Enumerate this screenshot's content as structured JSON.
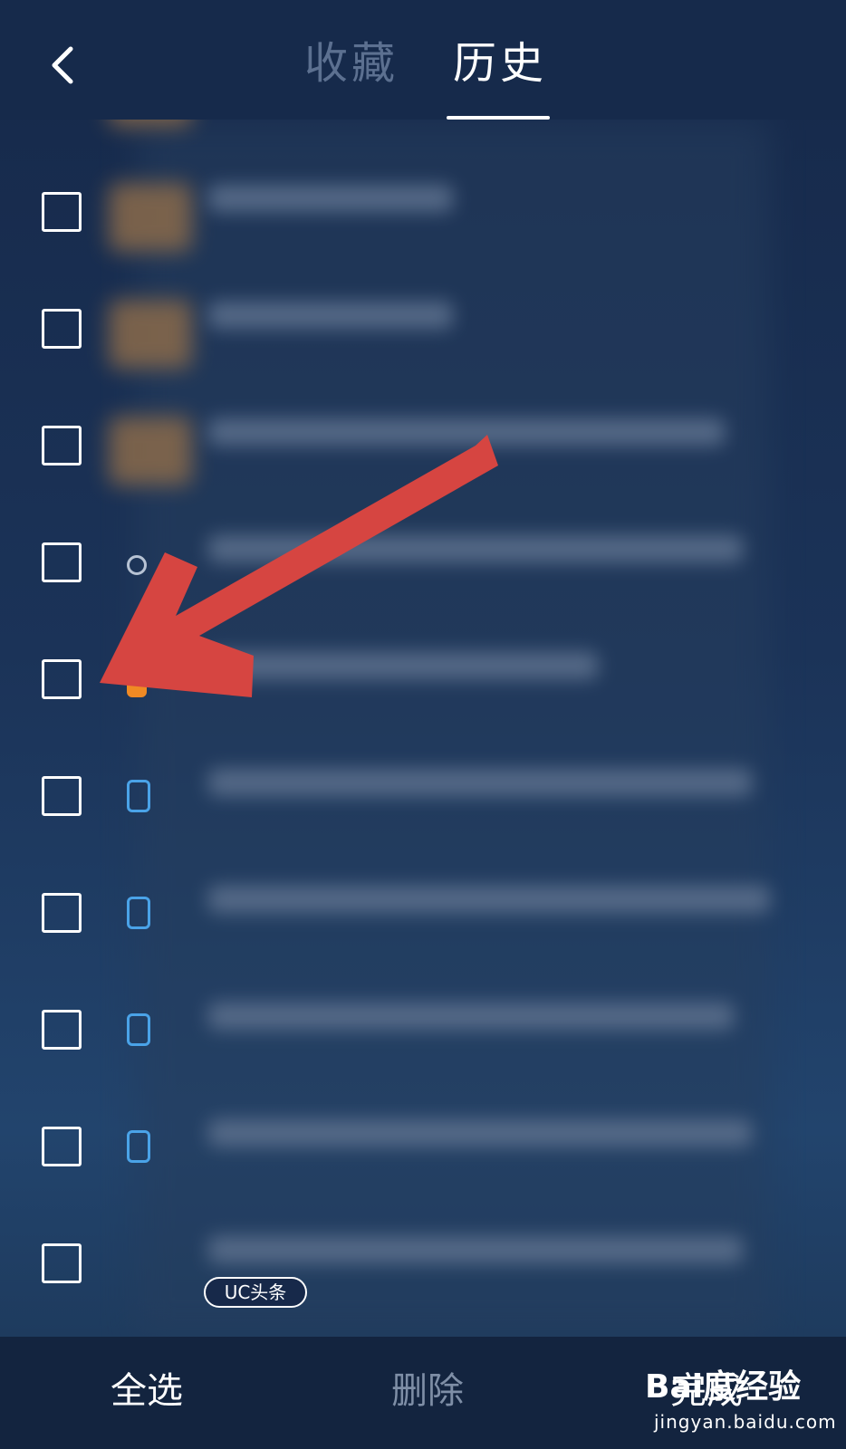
{
  "header": {
    "tabs": [
      {
        "label": "收藏",
        "active": false
      },
      {
        "label": "历史",
        "active": true
      }
    ]
  },
  "list": {
    "rows": [
      {
        "icon": "thumbnail-icon",
        "checked": false
      },
      {
        "icon": "thumbnail-icon",
        "checked": false
      },
      {
        "icon": "thumbnail-icon",
        "checked": false
      },
      {
        "icon": "thumbnail-icon",
        "checked": false
      },
      {
        "icon": "globe-icon",
        "checked": false
      },
      {
        "icon": "orange-site-icon",
        "checked": false
      },
      {
        "icon": "document-icon",
        "checked": false
      },
      {
        "icon": "document-icon",
        "checked": false
      },
      {
        "icon": "document-icon",
        "checked": false
      },
      {
        "icon": "document-icon",
        "checked": false
      },
      {
        "icon": "none",
        "checked": false
      }
    ],
    "tag": "UC头条"
  },
  "bottom_bar": {
    "select_all": "全选",
    "delete": "删除",
    "done": "完成"
  },
  "watermark": {
    "logo": "Bai度经验",
    "url": "jingyan.baidu.com"
  },
  "colors": {
    "background": "#1b3358",
    "header": "#162a4b",
    "inactive_tab": "#5c7090",
    "active_tab": "#ffffff",
    "delete_disabled": "#7e8ea6",
    "arrow": "#d64541",
    "link_icon": "#4aa3e8"
  }
}
